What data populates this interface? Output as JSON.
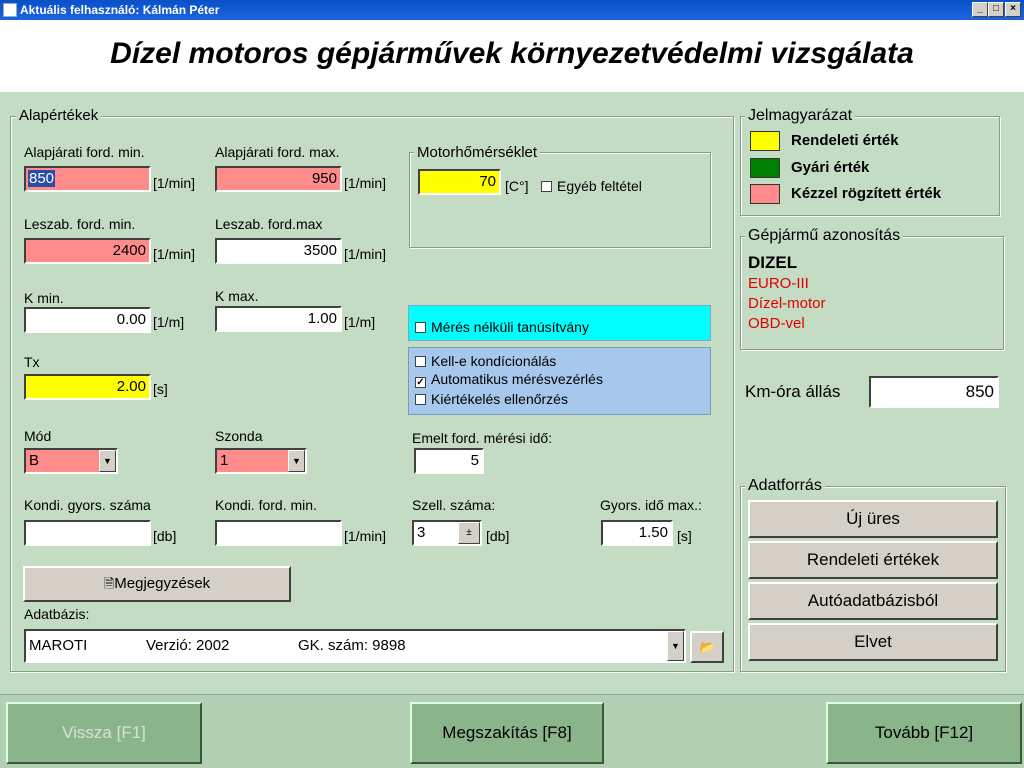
{
  "window": {
    "title": "Aktuális felhasználó: Kálmán Péter",
    "minimize": "_",
    "maximize": "□",
    "close": "×"
  },
  "headline": "Dízel motoros gépjárművek környezetvédelmi vizsgálata",
  "alapertekek": {
    "legend": "Alapértékek",
    "alap_min": {
      "label": "Alapjárati ford. min.",
      "value": "850",
      "unit": "[1/min]"
    },
    "alap_max": {
      "label": "Alapjárati ford. max.",
      "value": "950",
      "unit": "[1/min]"
    },
    "lesz_min": {
      "label": "Leszab. ford. min.",
      "value": "2400",
      "unit": "[1/min]"
    },
    "lesz_max": {
      "label": "Leszab. ford.max",
      "value": "3500",
      "unit": "[1/min]"
    },
    "k_min": {
      "label": "K min.",
      "value": "0.00",
      "unit": "[1/m]"
    },
    "k_max": {
      "label": "K max.",
      "value": "1.00",
      "unit": "[1/m]"
    },
    "tx": {
      "label": "Tx",
      "value": "2.00",
      "unit": "[s]"
    },
    "mod": {
      "label": "Mód",
      "value": "B"
    },
    "szonda": {
      "label": "Szonda",
      "value": "1"
    },
    "kondi_gyors": {
      "label": "Kondi. gyors. száma",
      "value": "",
      "unit": "[db]"
    },
    "kondi_ford": {
      "label": "Kondi. ford. min.",
      "value": "",
      "unit": "[1/min]"
    },
    "emelt": {
      "label": "Emelt ford. mérési idő:",
      "value": "5"
    },
    "szell": {
      "label": "Szell. száma:",
      "value": "3",
      "unit": "[db]"
    },
    "gyors_ido": {
      "label": "Gyors. idő max.:",
      "value": "1.50",
      "unit": "[s]"
    },
    "motorho": {
      "legend": "Motorhőmérséklet",
      "value": "70",
      "unit": "[C°]",
      "egyeb": "Egyéb feltétel"
    },
    "meres_nelkuli": "Mérés nélküli tanúsítvány",
    "kell_e": "Kell-e kondícionálás",
    "automatikus": "Automatikus mérésvezérlés",
    "kiertekeles": "Kiértékelés ellenőrzés",
    "check_mark": "✓",
    "megjegyzesek": "Megjegyzések",
    "adatbazis": {
      "label": "Adatbázis:",
      "name": "MAROTI",
      "verzio": "Verzió: 2002",
      "gk": "GK. szám: 9898"
    }
  },
  "jelmagyarazat": {
    "legend": "Jelmagyarázat",
    "items": [
      {
        "label": "Rendeleti érték",
        "color": "#ffff00"
      },
      {
        "label": "Gyári érték",
        "color": "#008000"
      },
      {
        "label": "Kézzel rögzített érték",
        "color": "#ff8b8b"
      }
    ]
  },
  "azonositas": {
    "legend": "Gépjármű azonosítás",
    "title": "DIZEL",
    "lines": [
      "EURO-III",
      "Dízel-motor",
      "OBD-vel"
    ]
  },
  "km_ora": {
    "label": "Km-óra állás",
    "value": "850"
  },
  "adatforras": {
    "legend": "Adatforrás",
    "buttons": [
      "Új üres",
      "Rendeleti értékek",
      "Autóadatbázisból",
      "Elvet"
    ]
  },
  "nav": {
    "vissza": "Vissza [F1]",
    "megszakitas": "Megszakítás [F8]",
    "tovabb": "Tovább [F12]"
  }
}
